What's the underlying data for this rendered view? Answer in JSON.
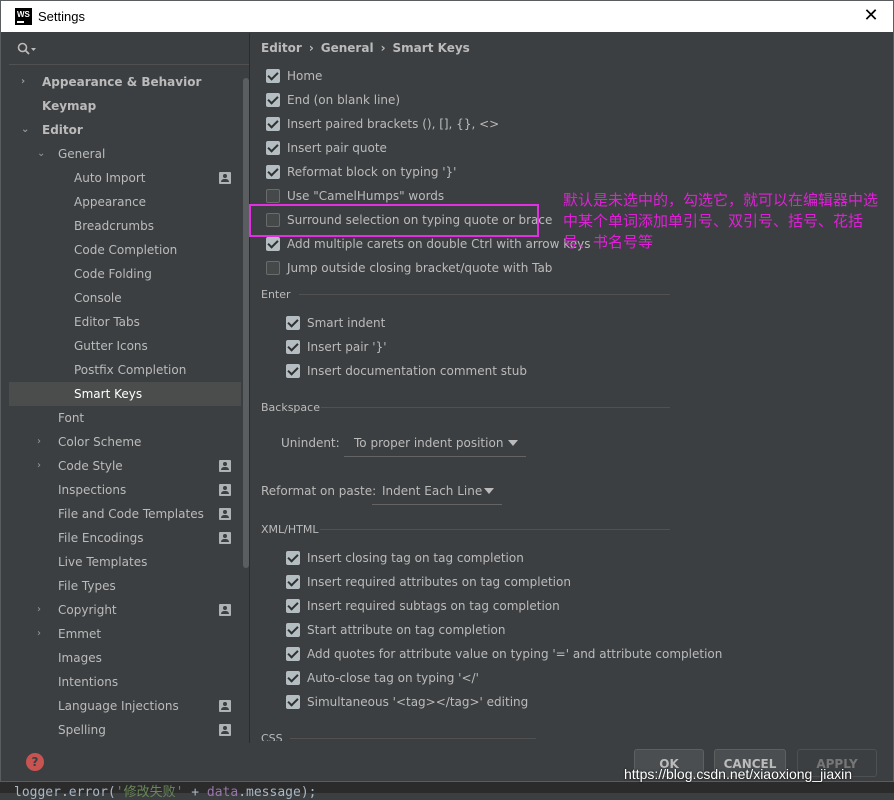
{
  "window": {
    "title": "Settings",
    "close_glyph": "✕",
    "logo_text": "WS"
  },
  "search": {
    "icon": "search-icon"
  },
  "tree": [
    {
      "label": "Appearance & Behavior",
      "level": 0,
      "bold": true,
      "arrow": "›"
    },
    {
      "label": "Keymap",
      "level": 0,
      "bold": true,
      "arrow": ""
    },
    {
      "label": "Editor",
      "level": 0,
      "bold": true,
      "arrow": "⌄"
    },
    {
      "label": "General",
      "level": 1,
      "bold": false,
      "arrow": "⌄"
    },
    {
      "label": "Auto Import",
      "level": 2,
      "bold": false,
      "arrow": "",
      "badge": true
    },
    {
      "label": "Appearance",
      "level": 2,
      "bold": false,
      "arrow": ""
    },
    {
      "label": "Breadcrumbs",
      "level": 2,
      "bold": false,
      "arrow": ""
    },
    {
      "label": "Code Completion",
      "level": 2,
      "bold": false,
      "arrow": ""
    },
    {
      "label": "Code Folding",
      "level": 2,
      "bold": false,
      "arrow": ""
    },
    {
      "label": "Console",
      "level": 2,
      "bold": false,
      "arrow": ""
    },
    {
      "label": "Editor Tabs",
      "level": 2,
      "bold": false,
      "arrow": ""
    },
    {
      "label": "Gutter Icons",
      "level": 2,
      "bold": false,
      "arrow": ""
    },
    {
      "label": "Postfix Completion",
      "level": 2,
      "bold": false,
      "arrow": ""
    },
    {
      "label": "Smart Keys",
      "level": 2,
      "bold": false,
      "arrow": "",
      "selected": true
    },
    {
      "label": "Font",
      "level": 1,
      "bold": false,
      "arrow": ""
    },
    {
      "label": "Color Scheme",
      "level": 1,
      "bold": false,
      "arrow": "›"
    },
    {
      "label": "Code Style",
      "level": 1,
      "bold": false,
      "arrow": "›",
      "badge": true
    },
    {
      "label": "Inspections",
      "level": 1,
      "bold": false,
      "arrow": "",
      "badge": true
    },
    {
      "label": "File and Code Templates",
      "level": 1,
      "bold": false,
      "arrow": "",
      "badge": true
    },
    {
      "label": "File Encodings",
      "level": 1,
      "bold": false,
      "arrow": "",
      "badge": true
    },
    {
      "label": "Live Templates",
      "level": 1,
      "bold": false,
      "arrow": ""
    },
    {
      "label": "File Types",
      "level": 1,
      "bold": false,
      "arrow": ""
    },
    {
      "label": "Copyright",
      "level": 1,
      "bold": false,
      "arrow": "›",
      "badge": true
    },
    {
      "label": "Emmet",
      "level": 1,
      "bold": false,
      "arrow": "›"
    },
    {
      "label": "Images",
      "level": 1,
      "bold": false,
      "arrow": ""
    },
    {
      "label": "Intentions",
      "level": 1,
      "bold": false,
      "arrow": ""
    },
    {
      "label": "Language Injections",
      "level": 1,
      "bold": false,
      "arrow": "",
      "badge": true
    },
    {
      "label": "Spelling",
      "level": 1,
      "bold": false,
      "arrow": "",
      "badge": true
    }
  ],
  "breadcrumb": {
    "part1": "Editor",
    "part2": "General",
    "part3": "Smart Keys",
    "sep": "›"
  },
  "top_options": [
    {
      "label": "Home",
      "checked": true
    },
    {
      "label": "End (on blank line)",
      "checked": true
    },
    {
      "label": "Insert paired brackets (), [], {}, <>",
      "checked": true
    },
    {
      "label": "Insert pair quote",
      "checked": true
    },
    {
      "label": "Reformat block on typing '}'",
      "checked": true
    },
    {
      "label": "Use \"CamelHumps\" words",
      "checked": false
    },
    {
      "label": "Surround selection on typing quote or brace",
      "checked": false
    },
    {
      "label": "Add multiple carets on double Ctrl with arrow keys",
      "checked": true
    },
    {
      "label": "Jump outside closing bracket/quote with Tab",
      "checked": false
    }
  ],
  "enter": {
    "title": "Enter",
    "options": [
      {
        "label": "Smart indent",
        "checked": true
      },
      {
        "label": "Insert pair '}'",
        "checked": true
      },
      {
        "label": "Insert documentation comment stub",
        "checked": true
      }
    ]
  },
  "backspace": {
    "title": "Backspace",
    "unindent_label": "Unindent:",
    "unindent_value": "To proper indent position"
  },
  "reformat": {
    "label": "Reformat on paste:",
    "value": "Indent Each Line"
  },
  "xml": {
    "title": "XML/HTML",
    "options": [
      {
        "label": "Insert closing tag on tag completion",
        "checked": true
      },
      {
        "label": "Insert required attributes on tag completion",
        "checked": true
      },
      {
        "label": "Insert required subtags on tag completion",
        "checked": true
      },
      {
        "label": "Start attribute on tag completion",
        "checked": true
      },
      {
        "label": "Add quotes for attribute value on typing '=' and attribute completion",
        "checked": true
      },
      {
        "label": "Auto-close tag on typing '</'",
        "checked": true
      },
      {
        "label": "Simultaneous '<tag></tag>' editing",
        "checked": true
      }
    ]
  },
  "css_title": "CSS",
  "annotation": "默认是未选中的，勾选它，就可以在编辑器中选中某个单词添加单引号、双引号、括号、花括号、书名号等",
  "buttons": {
    "ok": "OK",
    "cancel": "CANCEL",
    "apply": "APPLY"
  },
  "help_glyph": "?",
  "watermark": "https://blog.csdn.net/xiaoxiong_jiaxin",
  "editor_bottom": {
    "a": "logger.error(",
    "b": "'修改失败'",
    "c": " + ",
    "d": "data",
    "e": ".message);"
  },
  "colors": {
    "accent_highlight": "#e030e0",
    "annotation_text": "#e020d8",
    "bg": "#3c3f41",
    "help": "#c75450"
  }
}
